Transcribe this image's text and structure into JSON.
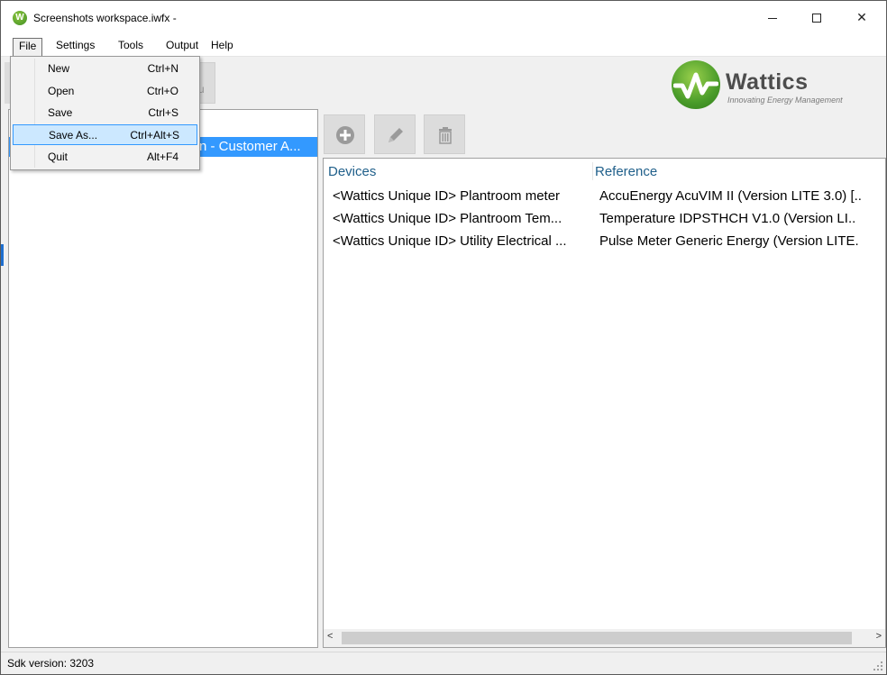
{
  "window": {
    "title": "Screenshots workspace.iwfx -",
    "app_icon_letter": "W",
    "minimize_icon": "minimize-icon",
    "maximize_icon": "maximize-icon",
    "close_glyph": "✕"
  },
  "menubar": {
    "items": [
      {
        "label": "File"
      },
      {
        "label": "Settings"
      },
      {
        "label": "Tools"
      },
      {
        "label": "Output"
      },
      {
        "label": "Help"
      }
    ]
  },
  "file_menu": {
    "items": [
      {
        "label": "New",
        "shortcut": "Ctrl+N"
      },
      {
        "label": "Open",
        "shortcut": "Ctrl+O"
      },
      {
        "label": "Save",
        "shortcut": "Ctrl+S"
      },
      {
        "label": "Save As...",
        "shortcut": "Ctrl+Alt+S",
        "highlighted": true
      },
      {
        "label": "Quit",
        "shortcut": "Alt+F4"
      }
    ]
  },
  "toolbar": {
    "partial_button_glyph": "u"
  },
  "logo": {
    "brand": "Wattics",
    "tagline": "Innovating Energy Management"
  },
  "tree": {
    "selected_item_visible": "n - Customer A..."
  },
  "actions": {
    "add_icon": "plus-circle-icon",
    "edit_icon": "pencil-icon",
    "delete_icon": "trash-icon"
  },
  "device_list": {
    "columns": [
      "Devices",
      "Reference"
    ],
    "rows": [
      [
        "<Wattics Unique ID> Plantroom meter",
        "AccuEnergy AcuVIM II (Version LITE 3.0) [.."
      ],
      [
        "<Wattics Unique ID> Plantroom Tem...",
        "Temperature IDPSTHCH V1.0 (Version LI.."
      ],
      [
        "<Wattics Unique ID> Utility Electrical ...",
        "Pulse Meter Generic Energy (Version LITE."
      ]
    ],
    "scroll_left": "<",
    "scroll_right": ">"
  },
  "statusbar": {
    "text": "Sdk version: 3203"
  },
  "colors": {
    "selection": "#3399ff",
    "menu_highlight": "#cce8ff",
    "header_text": "#1f5f8a",
    "brand_green": "#4a9c2a"
  }
}
